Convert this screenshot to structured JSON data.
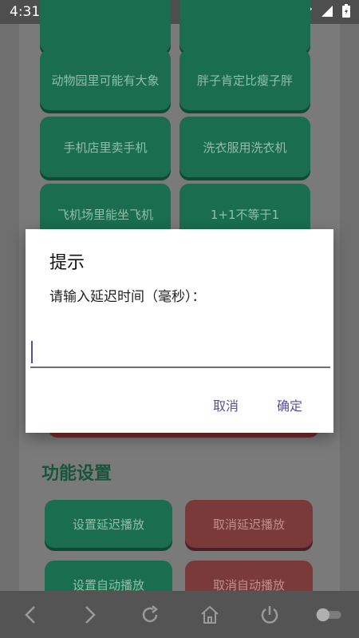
{
  "status_bar": {
    "time": "4:31"
  },
  "grid": {
    "row1": [
      "动物园里可能有大象",
      "胖子肯定比瘦子胖"
    ],
    "row2": [
      "手机店里卖手机",
      "洗衣服用洗衣机"
    ],
    "row3": [
      "飞机场里能坐飞机",
      "1+1不等于1"
    ]
  },
  "section": {
    "title": "功能设置",
    "buttons": [
      {
        "label": "设置延迟播放",
        "color": "green"
      },
      {
        "label": "取消延迟播放",
        "color": "red"
      },
      {
        "label": "设置自动播放",
        "color": "green"
      },
      {
        "label": "取消自动播放",
        "color": "red"
      }
    ]
  },
  "dialog": {
    "title": "提示",
    "message": "请输入延迟时间（毫秒）：",
    "input_value": "",
    "cancel_label": "取消",
    "ok_label": "确定"
  },
  "nav": {
    "icons": [
      "back-icon",
      "forward-icon",
      "refresh-icon",
      "home-icon",
      "power-icon",
      "toggle-icon"
    ]
  },
  "colors": {
    "accent": "#5b4d9c",
    "green_button": "#1a6e4f",
    "red_button": "#7a3a3a"
  }
}
